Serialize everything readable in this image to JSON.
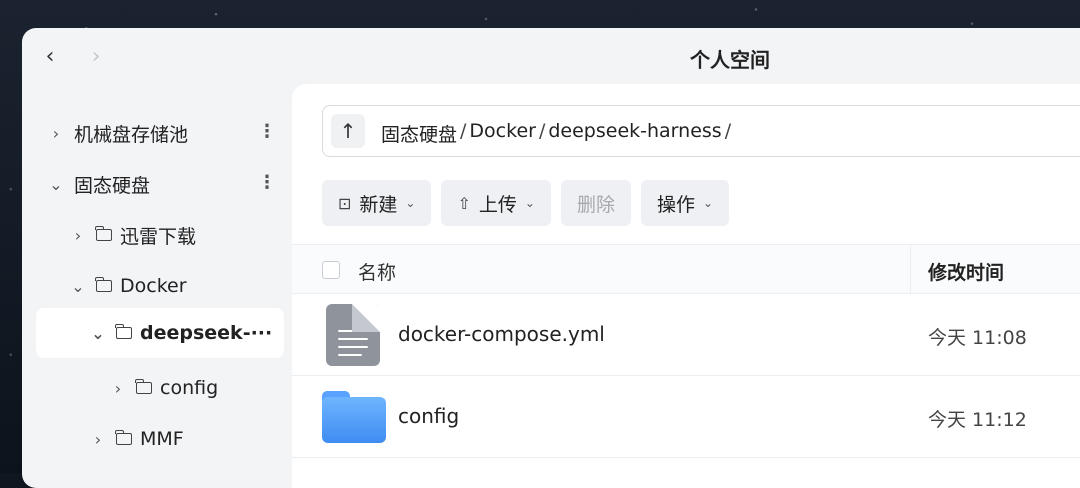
{
  "window": {
    "title": "个人空间"
  },
  "nav": {
    "back_icon": "chevron-left-icon",
    "forward_icon": "chevron-right-icon"
  },
  "sidebar": {
    "items": [
      {
        "label": "机械盘存储池",
        "expanded": false,
        "folder_icon": false,
        "more": true
      },
      {
        "label": "固态硬盘",
        "expanded": true,
        "folder_icon": false,
        "more": true
      },
      {
        "label": "迅雷下载",
        "expanded": false,
        "folder_icon": true
      },
      {
        "label": "Docker",
        "expanded": true,
        "folder_icon": true
      },
      {
        "label": "deepseek-···",
        "expanded": true,
        "folder_icon": true,
        "selected": true
      },
      {
        "label": "config",
        "expanded": false,
        "folder_icon": true
      },
      {
        "label": "MMF",
        "expanded": false,
        "folder_icon": true
      }
    ]
  },
  "path": {
    "up_icon": "arrow-up-icon",
    "segments": [
      "固态硬盘",
      "Docker",
      "deepseek-harness"
    ],
    "separator": "/"
  },
  "toolbar": {
    "new_label": "新建",
    "upload_label": "上传",
    "delete_label": "删除",
    "actions_label": "操作"
  },
  "table": {
    "col_name": "名称",
    "col_modified": "修改时间",
    "rows": [
      {
        "name": "docker-compose.yml",
        "modified": "今天 11:08",
        "type": "file"
      },
      {
        "name": "config",
        "modified": "今天 11:12",
        "type": "folder"
      }
    ]
  },
  "colors": {
    "folder": "#4a97f7",
    "selected_bg": "#ffffff",
    "window_bg": "#f3f4f6"
  }
}
